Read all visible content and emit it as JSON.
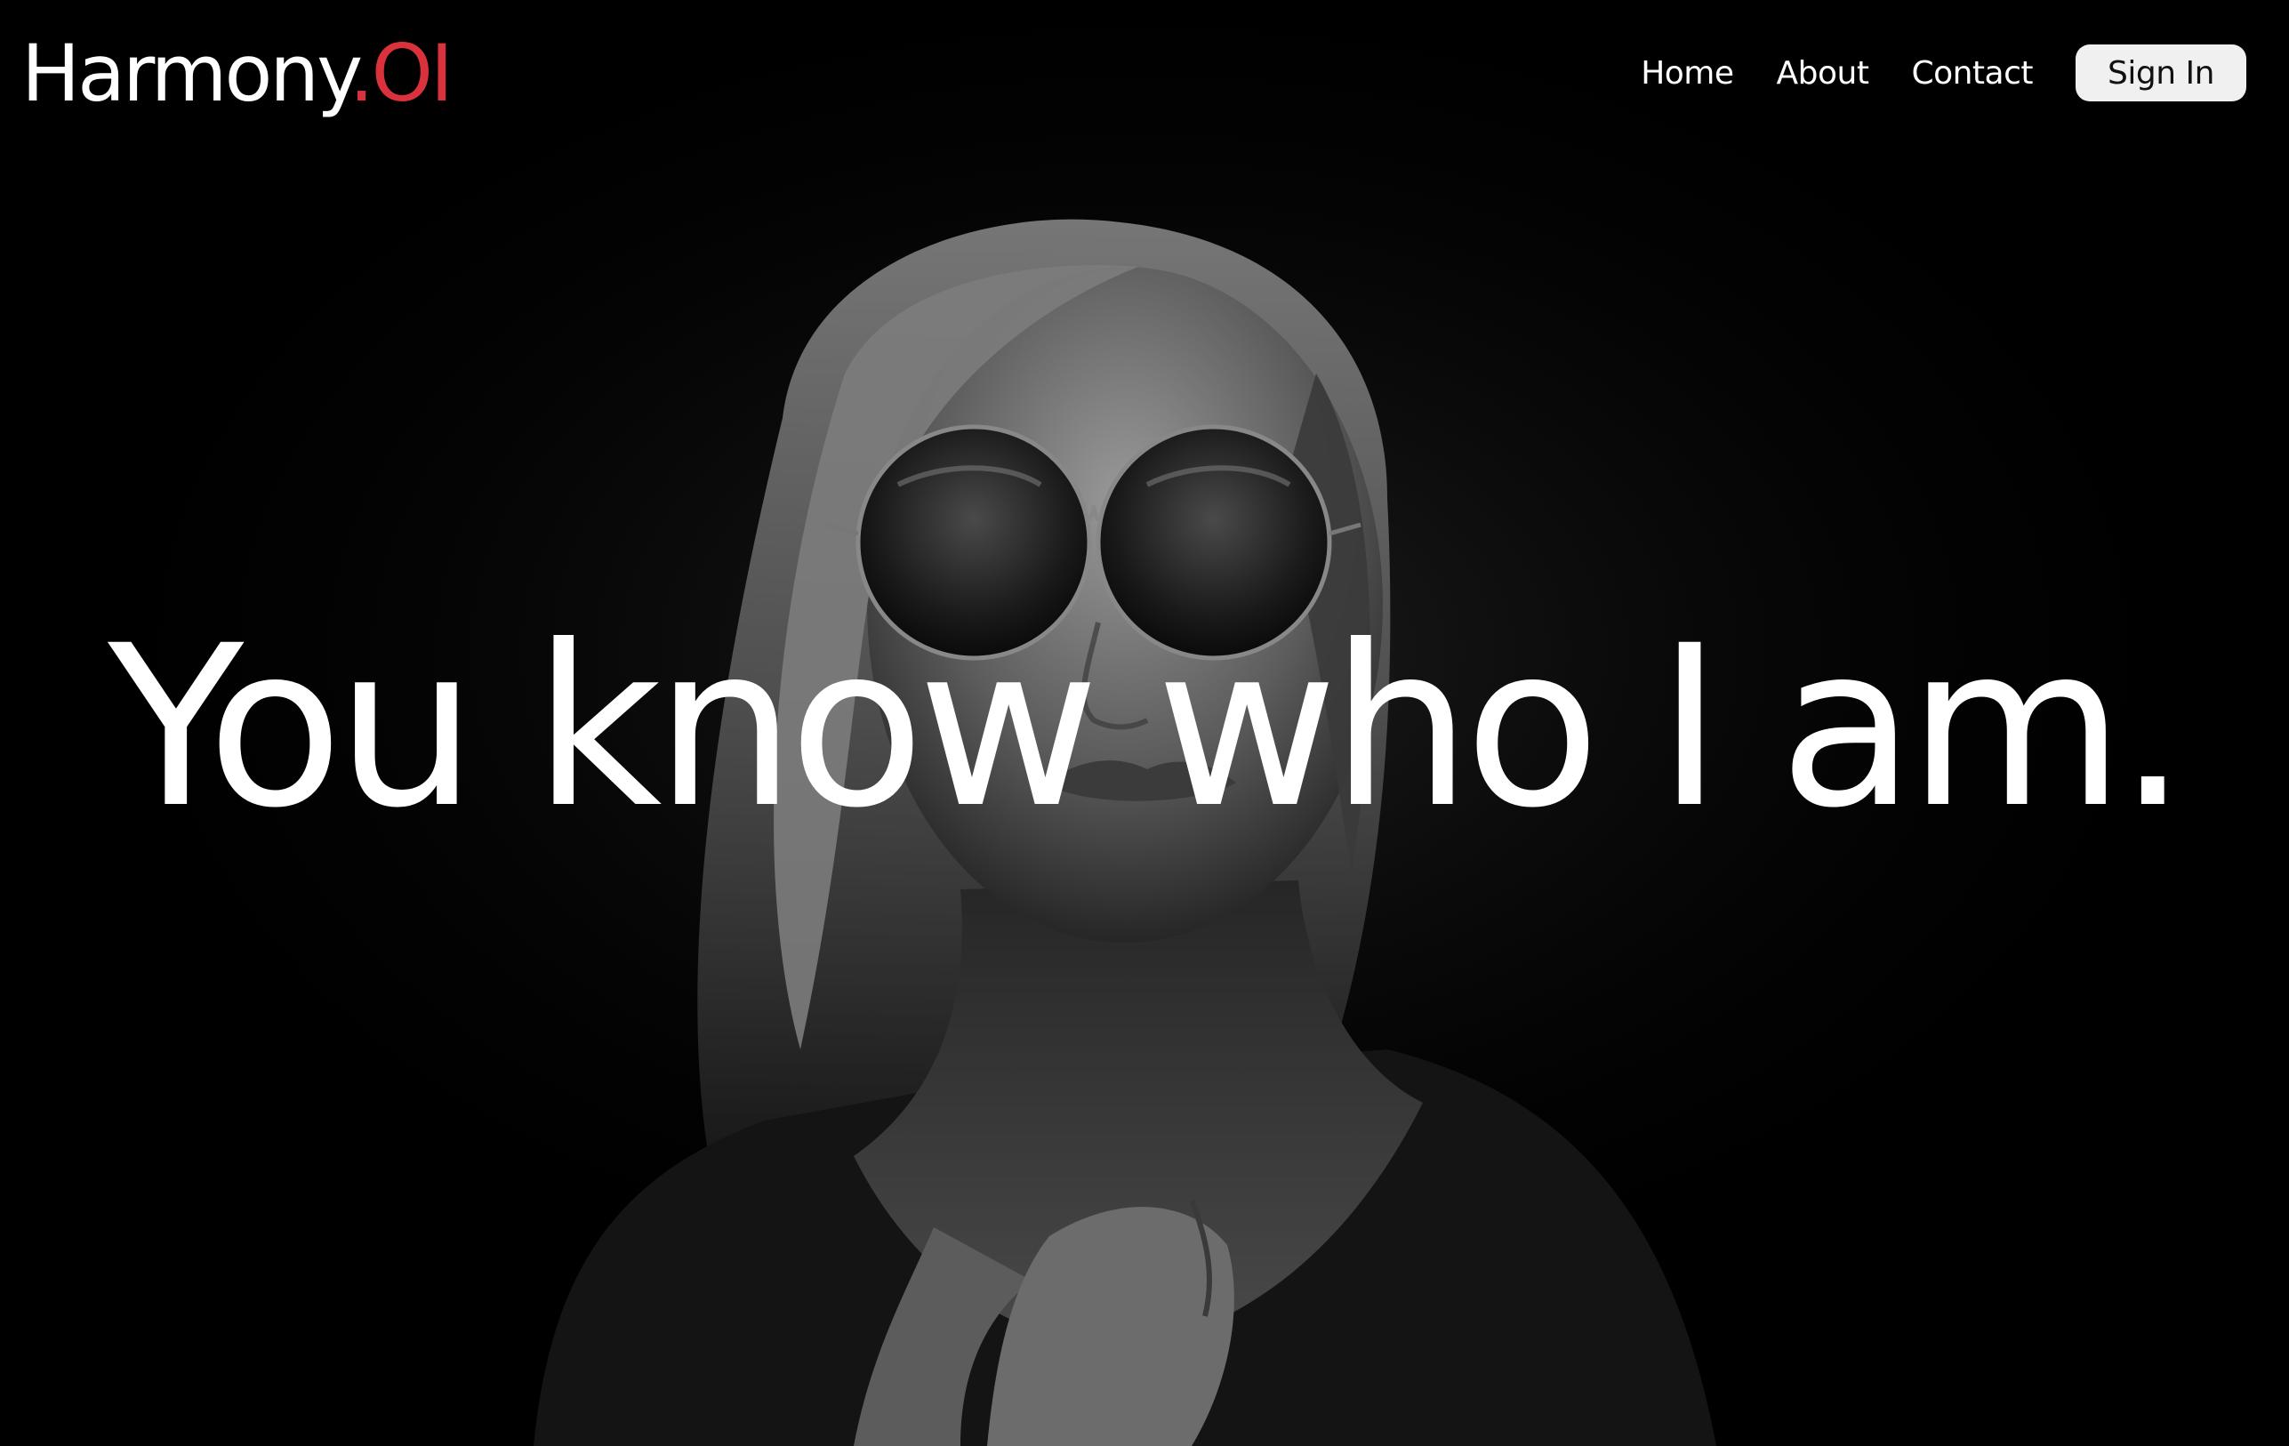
{
  "brand": {
    "name": "Harmony",
    "suffix": ".OI",
    "accent_color": "#d9323d"
  },
  "nav": {
    "links": [
      "Home",
      "About",
      "Contact"
    ],
    "sign_in": "Sign In"
  },
  "hero": {
    "headline": "You know who I am."
  }
}
